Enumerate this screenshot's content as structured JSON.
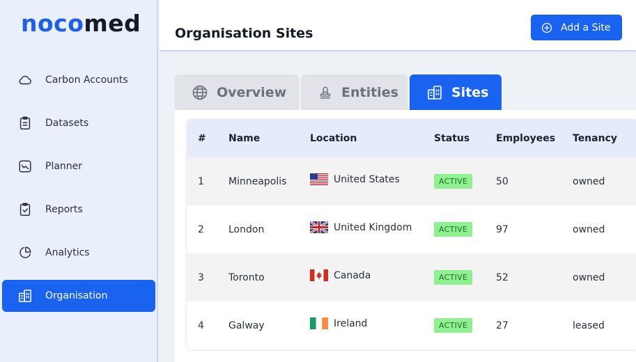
{
  "brand": {
    "part1": "noco",
    "part2": "med"
  },
  "sidebar": {
    "items": [
      {
        "label": "Carbon Accounts",
        "icon": "cloud-icon"
      },
      {
        "label": "Datasets",
        "icon": "clipboard-icon"
      },
      {
        "label": "Planner",
        "icon": "planner-icon"
      },
      {
        "label": "Reports",
        "icon": "clipboard-check-icon"
      },
      {
        "label": "Analytics",
        "icon": "pie-chart-icon"
      },
      {
        "label": "Organisation",
        "icon": "buildings-icon",
        "active": true
      }
    ]
  },
  "header": {
    "title": "Organisation Sites",
    "add_button": "Add a Site"
  },
  "tabs": [
    {
      "label": "Overview",
      "icon": "globe-icon"
    },
    {
      "label": "Entities",
      "icon": "stamp-icon"
    },
    {
      "label": "Sites",
      "icon": "buildings-icon",
      "active": true
    }
  ],
  "table": {
    "headers": [
      "#",
      "Name",
      "Location",
      "Status",
      "Employees",
      "Tenancy"
    ],
    "rows": [
      {
        "num": "1",
        "name": "Minneapolis",
        "location": "United States",
        "flag": "us",
        "status": "ACTIVE",
        "employees": "50",
        "tenancy": "owned"
      },
      {
        "num": "2",
        "name": "London",
        "location": "United Kingdom",
        "flag": "uk",
        "status": "ACTIVE",
        "employees": "97",
        "tenancy": "owned"
      },
      {
        "num": "3",
        "name": "Toronto",
        "location": "Canada",
        "flag": "ca",
        "status": "ACTIVE",
        "employees": "52",
        "tenancy": "owned"
      },
      {
        "num": "4",
        "name": "Galway",
        "location": "Ireland",
        "flag": "ie",
        "status": "ACTIVE",
        "employees": "27",
        "tenancy": "leased"
      }
    ]
  },
  "colors": {
    "accent": "#1a63f0",
    "sidebar_bg": "#eaf0fb",
    "badge_bg": "#8ff08f",
    "badge_text": "#1e6a2c"
  }
}
